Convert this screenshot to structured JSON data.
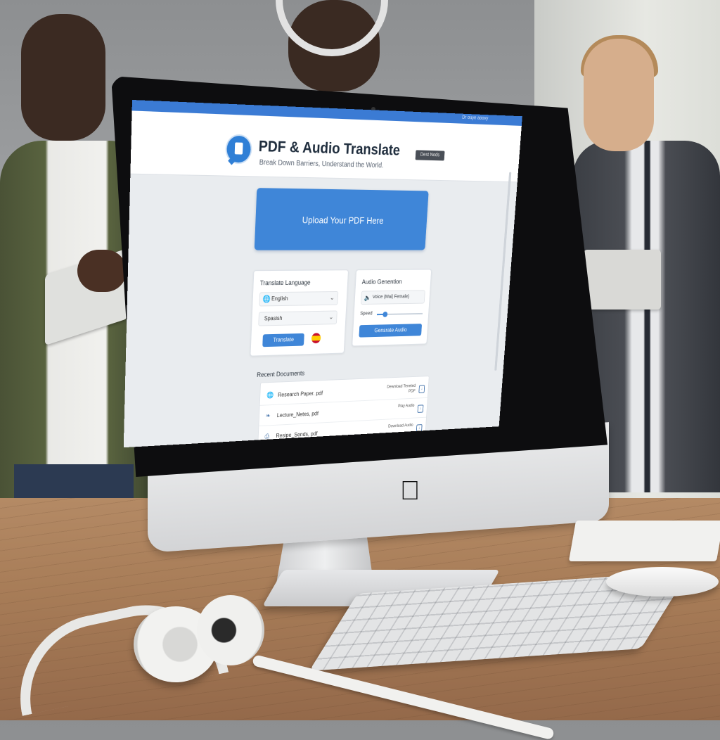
{
  "header": {
    "topbar_text": "Dr ouye aoovy",
    "app_title": "PDF & Audio Translate",
    "tagline": "Break Down Barriers, Understand the World.",
    "header_button": "Dest Nods"
  },
  "upload": {
    "label": "Upload Your PDF Here"
  },
  "translate": {
    "title": "Translate Language",
    "source_language": "English",
    "target_language": "Spasish",
    "button": "Translate",
    "flag_icon": "spain-flag-icon"
  },
  "audio": {
    "title": "Audio Genention",
    "voice_value": "Voice (Mai| Female)",
    "speed_label": "Speed",
    "speed_fraction": 0.18,
    "button": "Gensrate Audio"
  },
  "recent": {
    "title": "Recent Documents",
    "documents": [
      {
        "name": "Research Paper. pdf",
        "action": "Dewnload Teneted PDF",
        "icon": "globe-icon"
      },
      {
        "name": "Lecture_Netes, pdf",
        "action": "Play Audio",
        "icon": "language-icon"
      },
      {
        "name": "Resipe_Sends, pdf",
        "action": "Download Audio",
        "icon": "document-icon"
      }
    ]
  },
  "colors": {
    "accent": "#3f86d8",
    "topbar": "#3b7bd4",
    "header_button_bg": "#4a4f57"
  }
}
